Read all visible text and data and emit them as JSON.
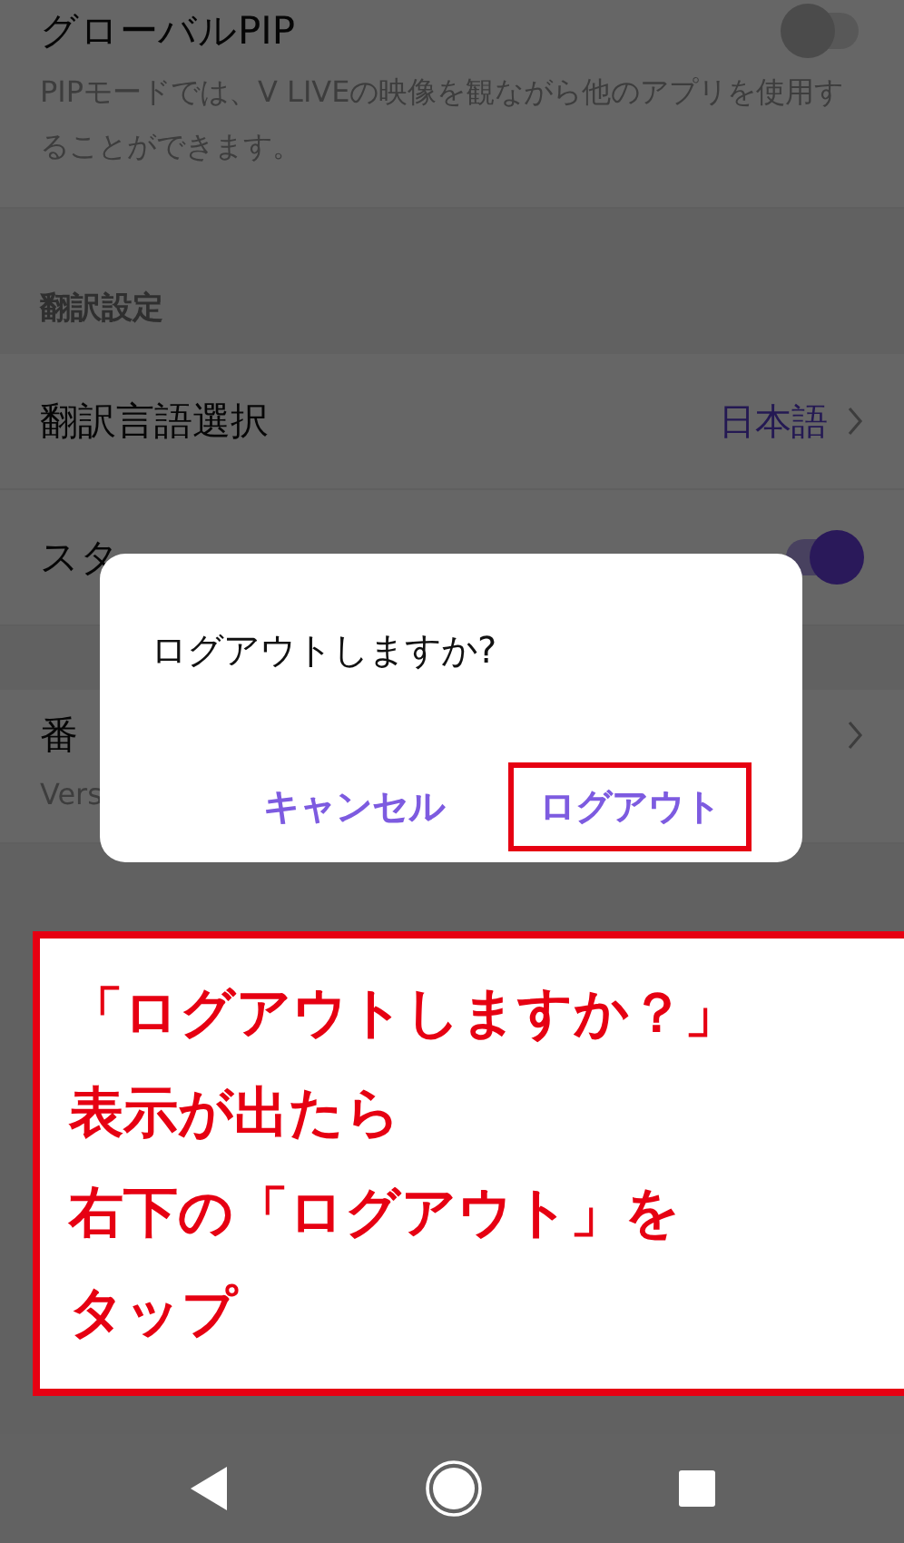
{
  "settings": {
    "rows": [
      {
        "kind": "toggle",
        "title": "グローバルPIP",
        "description": "PIPモードでは、V LIVEの映像を観ながら他のアプリを使用することができます。",
        "on": false
      },
      {
        "kind": "section",
        "title": "翻訳設定"
      },
      {
        "kind": "link",
        "title": "翻訳言語選択",
        "value": "日本語"
      },
      {
        "kind": "toggle",
        "title": "スタ",
        "on": true
      },
      {
        "kind": "gap"
      },
      {
        "kind": "link",
        "title": "番",
        "subtitle": "Vers"
      }
    ]
  },
  "dialog": {
    "message": "ログアウトしますか?",
    "buttons": [
      {
        "label": "キャンセル",
        "highlighted": false
      },
      {
        "label": "ログアウト",
        "highlighted": true
      }
    ]
  },
  "annotation": {
    "lines": [
      "「ログアウトしますか？」",
      "表示が出たら",
      "右下の「ログアウト」を",
      "タップ"
    ]
  },
  "nav_bar": {
    "buttons": [
      {
        "kind": "back"
      },
      {
        "kind": "home"
      },
      {
        "kind": "recents"
      }
    ]
  }
}
